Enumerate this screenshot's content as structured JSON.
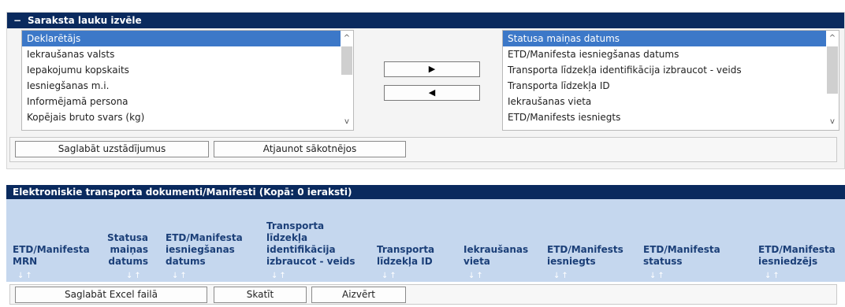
{
  "field_panel": {
    "title": "Saraksta lauku izvēle",
    "collapse_symbol": "−",
    "available_fields": [
      "Deklarētājs",
      "Iekraušanas valsts",
      "Iepakojumu kopskaits",
      "Iesniegšanas m.i.",
      "Informējamā persona",
      "Kopējais bruto svars (kg)"
    ],
    "selected_fields": [
      "Statusa maiņas datums",
      "ETD/Manifesta iesniegšanas datums",
      "Transporta līdzekļa identifikācija izbraucot - veids",
      "Transporta līdzekļa ID",
      "Iekraušanas vieta",
      "ETD/Manifests iesniegts"
    ],
    "move_right_glyph": "▶",
    "move_left_glyph": "◀",
    "scroll_up_glyph": "^",
    "scroll_down_glyph": "v",
    "save_settings_label": "Saglabāt uzstādījumus",
    "reset_label": "Atjaunot sākotnējos"
  },
  "grid": {
    "title": "Elektroniskie transporta dokumenti/Manifesti (Kopā: 0 ieraksti)",
    "sort_glyph": "↓↑",
    "columns": [
      "ETD/Manifesta\nMRN",
      "Statusa\nmaiņas\ndatums",
      "ETD/Manifesta\niesniegšanas\ndatums",
      "Transporta\nlīdzekļa\nidentifikācija\nizbraucot - veids",
      "Transporta\nlīdzekļa ID",
      "Iekraušanas\nvieta",
      "ETD/Manifests\niesniegts",
      "ETD/Manifesta\nstatuss",
      "ETD/Manifesta\niesniedzējs"
    ]
  },
  "footer": {
    "save_excel_label": "Saglabāt Excel failā",
    "view_label": "Skatīt",
    "close_label": "Aizvērt"
  },
  "colors": {
    "header_bg": "#0a2a5e",
    "selection": "#3c78c8",
    "grid_header_bg": "#c5d7ee",
    "column_text": "#1b3f78"
  }
}
